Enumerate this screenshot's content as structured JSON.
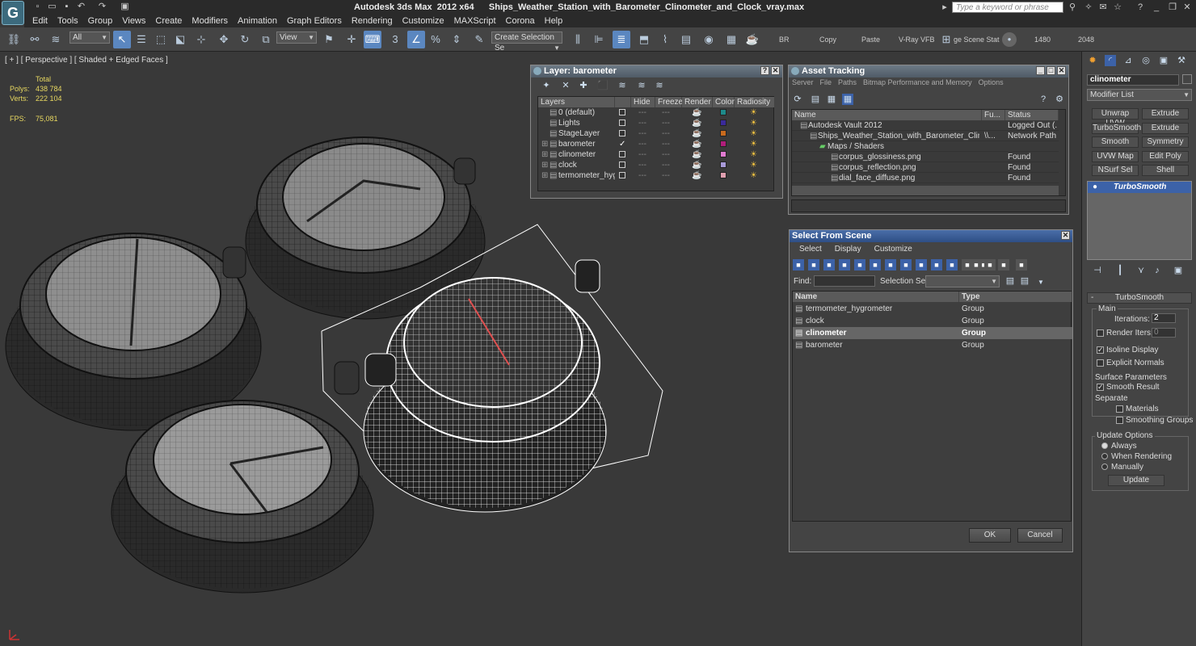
{
  "title": {
    "text": "Autodesk 3ds Max  2012 x64      Ships_Weather_Station_with_Barometer_Clinometer_and_Clock_vray.max",
    "search_placeholder": "Type a keyword or phrase",
    "logo": "3ds-max-logo"
  },
  "menu": [
    "Edit",
    "Tools",
    "Group",
    "Views",
    "Create",
    "Modifiers",
    "Animation",
    "Graph Editors",
    "Rendering",
    "Customize",
    "MAXScript",
    "Corona",
    "Help"
  ],
  "toolbar": {
    "selection_filter": "All",
    "ref_coord": "View",
    "named_set": "Create Selection Se",
    "snap_value": "3",
    "labels": {
      "br": "BR",
      "copy": "Copy",
      "paste": "Paste",
      "vray_vfb": "V-Ray VFB",
      "scene_states": "ge Scene Stat",
      "width": "1480",
      "height": "2048"
    }
  },
  "viewport": {
    "label": "[ + ] [ Perspective ] [ Shaded + Edged Faces ]",
    "stats": {
      "total_label": "Total",
      "polys_label": "Polys:",
      "polys": "438 784",
      "verts_label": "Verts:",
      "verts": "222 104",
      "fps_label": "FPS:",
      "fps": "75,081"
    }
  },
  "layer_panel": {
    "title": "Layer: barometer",
    "columns": [
      "Layers",
      "Hide",
      "Freeze",
      "Render",
      "Color",
      "Radiosity"
    ],
    "rows": [
      {
        "name": "0 (default)",
        "color": "#1e8a8a",
        "active": false
      },
      {
        "name": "Lights",
        "color": "#3a2a9a",
        "active": false
      },
      {
        "name": "StageLayer",
        "color": "#c86a1e",
        "active": false
      },
      {
        "name": "barometer",
        "color": "#b01e7a",
        "active": true
      },
      {
        "name": "clinometer",
        "color": "#e07ad0",
        "active": false
      },
      {
        "name": "clock",
        "color": "#a89ad8",
        "active": false
      },
      {
        "name": "termometer_hygron",
        "color": "#e0a0b0",
        "active": false
      }
    ]
  },
  "asset_panel": {
    "title": "Asset Tracking",
    "menu": [
      "Server",
      "File",
      "Paths",
      "Bitmap Performance and Memory",
      "Options"
    ],
    "columns": [
      "Name",
      "Fu...",
      "Status"
    ],
    "rows": [
      {
        "name": "Autodesk Vault 2012",
        "fu": "",
        "status": "Logged Out (..."
      },
      {
        "name": "Ships_Weather_Station_with_Barometer_Clinom...",
        "fu": "\\\\...",
        "status": "Network Path"
      },
      {
        "name": "Maps / Shaders",
        "fu": "",
        "status": ""
      },
      {
        "name": "corpus_glossiness.png",
        "fu": "",
        "status": "Found"
      },
      {
        "name": "corpus_reflection.png",
        "fu": "",
        "status": "Found"
      },
      {
        "name": "dial_face_diffuse.png",
        "fu": "",
        "status": "Found"
      }
    ]
  },
  "select_panel": {
    "title": "Select From Scene",
    "tabs": [
      "Select",
      "Display",
      "Customize"
    ],
    "find_label": "Find:",
    "selection_set_label": "Selection Set:",
    "columns": [
      "Name",
      "Type"
    ],
    "rows": [
      {
        "name": "termometer_hygrometer",
        "type": "Group",
        "selected": false
      },
      {
        "name": "clock",
        "type": "Group",
        "selected": false
      },
      {
        "name": "clinometer",
        "type": "Group",
        "selected": true
      },
      {
        "name": "barometer",
        "type": "Group",
        "selected": false
      }
    ],
    "ok": "OK",
    "cancel": "Cancel"
  },
  "command_panel": {
    "object_name": "clinometer",
    "modifier_list": "Modifier List",
    "buttons": [
      [
        "Unwrap UVW",
        "Extrude"
      ],
      [
        "TurboSmooth",
        "Extrude"
      ],
      [
        "Smooth",
        "Symmetry"
      ],
      [
        "UVW Map",
        "Edit Poly"
      ],
      [
        "NSurf Sel",
        "Shell"
      ]
    ],
    "stack_item": "TurboSmooth",
    "rollout": {
      "title": "TurboSmooth",
      "main": "Main",
      "iterations_label": "Iterations:",
      "iterations": "2",
      "render_iters_label": "Render Iters:",
      "render_iters": "0",
      "isoline": "Isoline Display",
      "explicit": "Explicit Normals",
      "surface": "Surface Parameters",
      "smooth_result": "Smooth Result",
      "separate": "Separate",
      "materials": "Materials",
      "smoothing_groups": "Smoothing Groups",
      "update_options": "Update Options",
      "always": "Always",
      "when_rendering": "When Rendering",
      "manually": "Manually",
      "update": "Update"
    }
  }
}
